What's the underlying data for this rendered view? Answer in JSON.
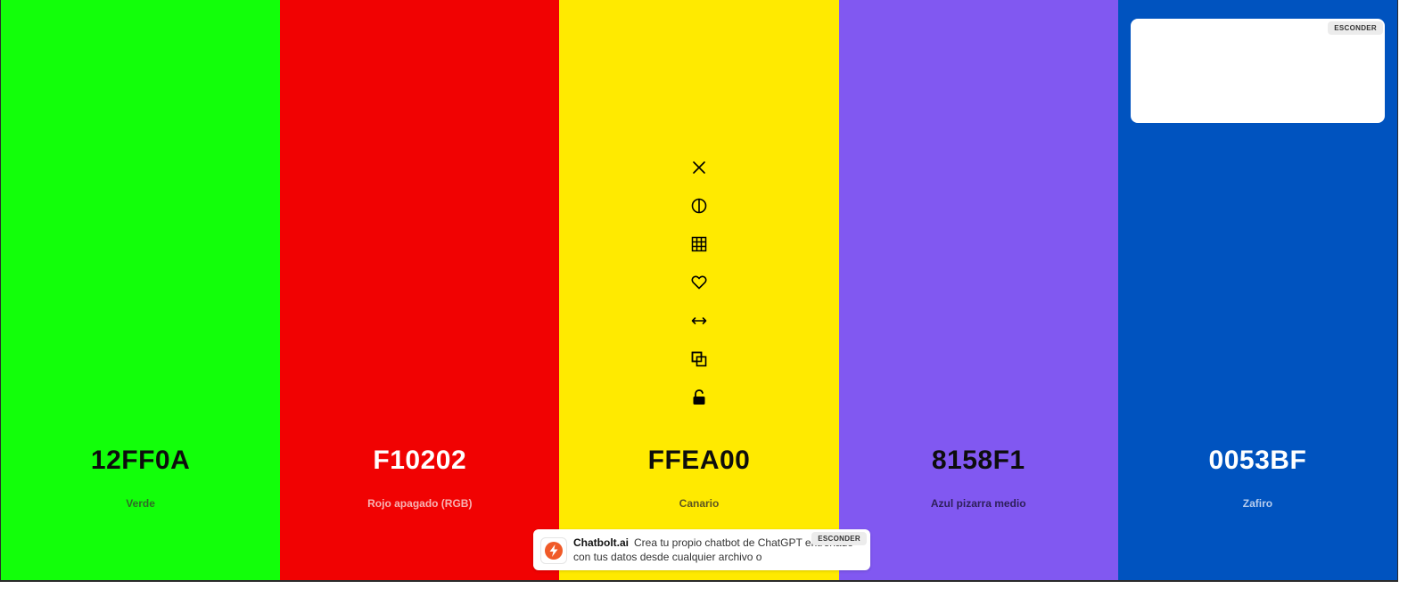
{
  "palette": {
    "swatches": [
      {
        "hex": "12FF0A",
        "name": "Verde",
        "color": "#12FF0A",
        "hex_color": "#0d0d0d",
        "name_color": "#2f6b26"
      },
      {
        "hex": "F10202",
        "name": "Rojo apagado (RGB)",
        "color": "#F10202",
        "hex_color": "#ffffff",
        "name_color": "#f7b3b3"
      },
      {
        "hex": "FFEA00",
        "name": "Canario",
        "color": "#FFEA00",
        "hex_color": "#0d0d0d",
        "name_color": "#5e5620"
      },
      {
        "hex": "8158F1",
        "name": "Azul pizarra medio",
        "color": "#8158F1",
        "hex_color": "#0d0d0d",
        "name_color": "#2d1f5a"
      },
      {
        "hex": "0053BF",
        "name": "Zafiro",
        "color": "#0053BF",
        "hex_color": "#ffffff",
        "name_color": "#b7cdee"
      }
    ],
    "toolbar_icons": [
      "close-icon",
      "contrast-icon",
      "grid-icon",
      "heart-icon",
      "drag-horizontal-icon",
      "copy-icon",
      "unlock-icon"
    ]
  },
  "top_ad": {
    "hide_label": "ESCONDER"
  },
  "bottom_ad": {
    "brand": "Chatbolt.ai",
    "text": "Crea tu propio chatbot de ChatGPT entrenado con tus datos desde cualquier archivo o",
    "hide_label": "ESCONDER",
    "logo_color": "#F05A28"
  }
}
